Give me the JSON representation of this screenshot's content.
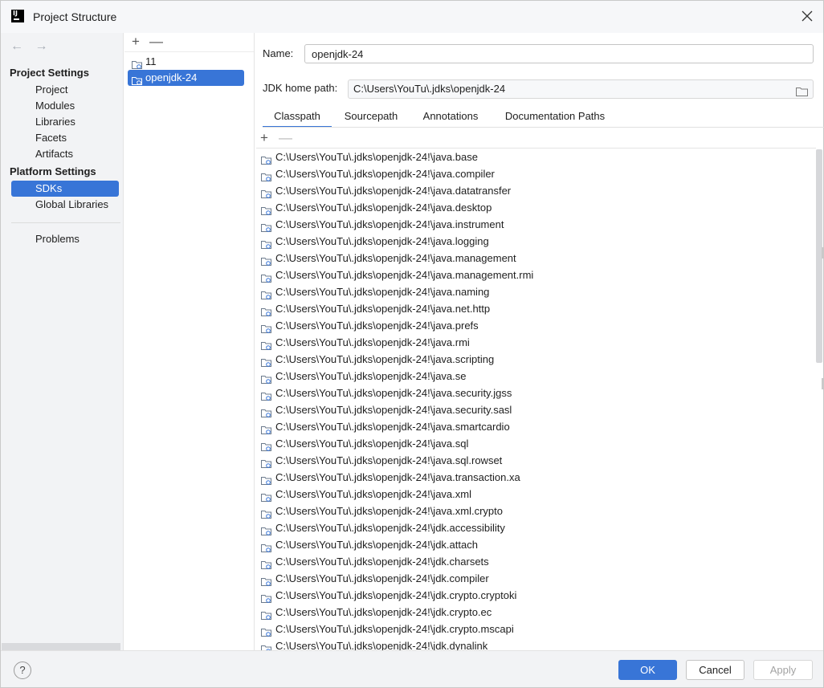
{
  "window": {
    "title": "Project Structure",
    "logo_text": "IJ"
  },
  "nav": {
    "back_arrow": "←",
    "forward_arrow": "→",
    "project_settings_title": "Project Settings",
    "project_items": [
      "Project",
      "Modules",
      "Libraries",
      "Facets",
      "Artifacts"
    ],
    "platform_settings_title": "Platform Settings",
    "platform_items": [
      "SDKs",
      "Global Libraries"
    ],
    "selected_item": "SDKs",
    "problems_label": "Problems"
  },
  "sdk_list": {
    "add_label": "+",
    "remove_label": "—",
    "items": [
      "11",
      "openjdk-24"
    ],
    "selected": "openjdk-24"
  },
  "detail": {
    "name_label": "Name:",
    "name_value": "openjdk-24",
    "home_label": "JDK home path:",
    "home_value": "C:\\Users\\YouTu\\.jdks\\openjdk-24",
    "tabs": [
      "Classpath",
      "Sourcepath",
      "Annotations",
      "Documentation Paths"
    ],
    "active_tab": "Classpath",
    "add_label": "+",
    "remove_label": "—"
  },
  "classpath": [
    "C:\\Users\\YouTu\\.jdks\\openjdk-24!\\java.base",
    "C:\\Users\\YouTu\\.jdks\\openjdk-24!\\java.compiler",
    "C:\\Users\\YouTu\\.jdks\\openjdk-24!\\java.datatransfer",
    "C:\\Users\\YouTu\\.jdks\\openjdk-24!\\java.desktop",
    "C:\\Users\\YouTu\\.jdks\\openjdk-24!\\java.instrument",
    "C:\\Users\\YouTu\\.jdks\\openjdk-24!\\java.logging",
    "C:\\Users\\YouTu\\.jdks\\openjdk-24!\\java.management",
    "C:\\Users\\YouTu\\.jdks\\openjdk-24!\\java.management.rmi",
    "C:\\Users\\YouTu\\.jdks\\openjdk-24!\\java.naming",
    "C:\\Users\\YouTu\\.jdks\\openjdk-24!\\java.net.http",
    "C:\\Users\\YouTu\\.jdks\\openjdk-24!\\java.prefs",
    "C:\\Users\\YouTu\\.jdks\\openjdk-24!\\java.rmi",
    "C:\\Users\\YouTu\\.jdks\\openjdk-24!\\java.scripting",
    "C:\\Users\\YouTu\\.jdks\\openjdk-24!\\java.se",
    "C:\\Users\\YouTu\\.jdks\\openjdk-24!\\java.security.jgss",
    "C:\\Users\\YouTu\\.jdks\\openjdk-24!\\java.security.sasl",
    "C:\\Users\\YouTu\\.jdks\\openjdk-24!\\java.smartcardio",
    "C:\\Users\\YouTu\\.jdks\\openjdk-24!\\java.sql",
    "C:\\Users\\YouTu\\.jdks\\openjdk-24!\\java.sql.rowset",
    "C:\\Users\\YouTu\\.jdks\\openjdk-24!\\java.transaction.xa",
    "C:\\Users\\YouTu\\.jdks\\openjdk-24!\\java.xml",
    "C:\\Users\\YouTu\\.jdks\\openjdk-24!\\java.xml.crypto",
    "C:\\Users\\YouTu\\.jdks\\openjdk-24!\\jdk.accessibility",
    "C:\\Users\\YouTu\\.jdks\\openjdk-24!\\jdk.attach",
    "C:\\Users\\YouTu\\.jdks\\openjdk-24!\\jdk.charsets",
    "C:\\Users\\YouTu\\.jdks\\openjdk-24!\\jdk.compiler",
    "C:\\Users\\YouTu\\.jdks\\openjdk-24!\\jdk.crypto.cryptoki",
    "C:\\Users\\YouTu\\.jdks\\openjdk-24!\\jdk.crypto.ec",
    "C:\\Users\\YouTu\\.jdks\\openjdk-24!\\jdk.crypto.mscapi",
    "C:\\Users\\YouTu\\.jdks\\openjdk-24!\\jdk.dynalink"
  ],
  "footer": {
    "help_label": "?",
    "ok_label": "OK",
    "cancel_label": "Cancel",
    "apply_label": "Apply"
  },
  "colors": {
    "accent": "#3875d7",
    "sidebar_bg": "#f2f3f5",
    "folder_icon": "#6b7a8c"
  }
}
